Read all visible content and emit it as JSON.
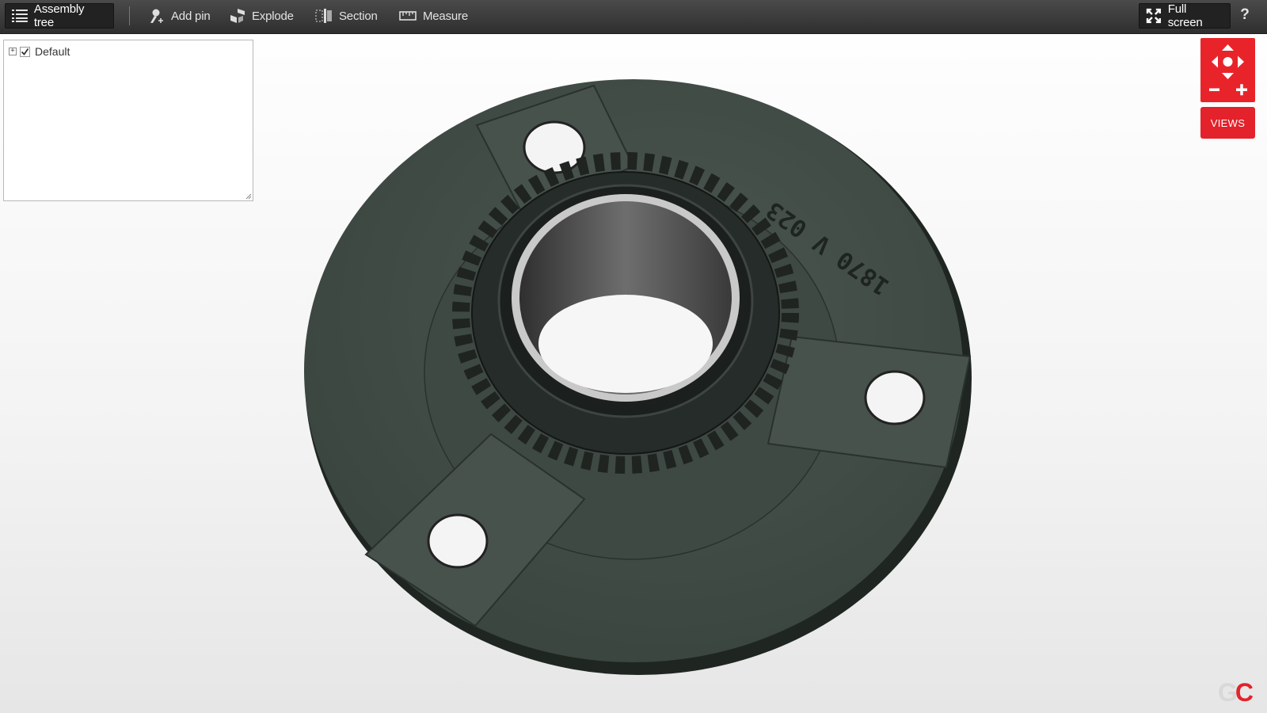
{
  "toolbar": {
    "assembly_tree": "Assembly tree",
    "add_pin": "Add pin",
    "explode": "Explode",
    "section": "Section",
    "measure": "Measure",
    "full_screen": "Full screen",
    "help": "?"
  },
  "tree": {
    "items": [
      {
        "label": "Default",
        "checked": true,
        "expander": "+"
      }
    ]
  },
  "navigation": {
    "views_label": "VIEWS"
  },
  "model": {
    "engraving": "1870 V 023"
  },
  "brand": {
    "logo_left": "G",
    "logo_right": "C"
  },
  "colors": {
    "accent": "#e3222b",
    "toolbar": "#3a3a3a",
    "model": "#3b4640"
  }
}
